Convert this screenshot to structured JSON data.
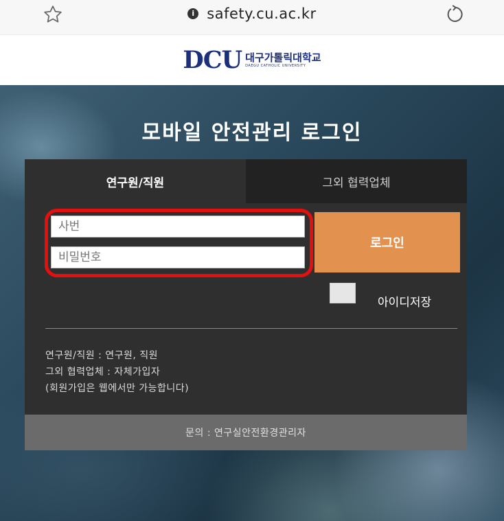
{
  "browser": {
    "url": "safety.cu.ac.kr",
    "icons": {
      "bookmark": "star-outline-icon",
      "lock": "info-circle-icon",
      "reload": "reload-icon"
    }
  },
  "header": {
    "logo_mark": "DCU",
    "logo_korean": "대구가톨릭대학교",
    "logo_english": "DAEGU CATHOLIC UNIVERSITY"
  },
  "page_title": "모바일 안전관리 로그인",
  "tabs": [
    {
      "label": "연구원/직원",
      "active": true
    },
    {
      "label": "그외 협력업체",
      "active": false
    }
  ],
  "form": {
    "id_placeholder": "사번",
    "password_placeholder": "비밀번호",
    "login_label": "로그인",
    "save_id_label": "아이디저장",
    "save_id_checked": false
  },
  "info_lines": [
    "연구원/직원 : 연구원, 직원",
    "그외 협력업체 : 자체가입자",
    "(회원가입은 웹에서만 가능합니다)"
  ],
  "footer": "문의 : 연구실안전환경관리자",
  "colors": {
    "accent": "#e2914f",
    "highlight": "#e31010",
    "panel": "#2f2f2f",
    "logo": "#1c2f7a"
  }
}
